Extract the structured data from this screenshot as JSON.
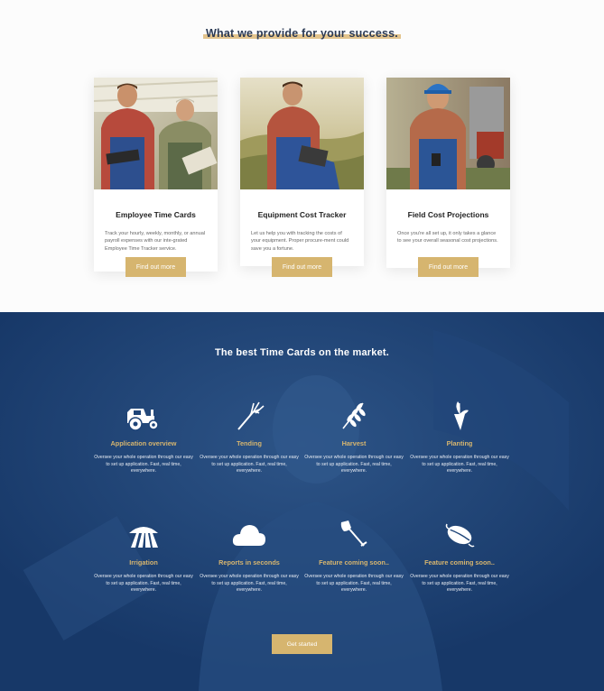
{
  "top_section": {
    "title": "What we provide for your success."
  },
  "cards": [
    {
      "title": "Employee Time Cards",
      "description": "Track your hourly, weekly, monthly, or annual payroll expenses with our inte-grated Employee Time Tracker service.",
      "button": "Find out more"
    },
    {
      "title": "Equipment Cost Tracker",
      "description": "Let us help you with tracking the costs of your equipment. Proper procure-ment could save you a fortune.",
      "button": "Find out more"
    },
    {
      "title": "Field Cost Projections",
      "description": "Once you're all set up, it only takes a glance to see your overall seasonal cost projections.",
      "button": "Find out more"
    }
  ],
  "features_section": {
    "title": "The best Time Cards on the market.",
    "button": "Get started"
  },
  "features": [
    {
      "icon": "tractor-icon",
      "title": "Application overview",
      "description": "Oversee your whole operation through our easy to set up application. Fast, real time, everywhere."
    },
    {
      "icon": "pitchfork-icon",
      "title": "Tending",
      "description": "Oversee your whole operation through our easy to set up application. Fast, real time, everywhere."
    },
    {
      "icon": "wheat-icon",
      "title": "Harvest",
      "description": "Oversee your whole operation through our easy to set up application. Fast, real time, everywhere."
    },
    {
      "icon": "plant-icon",
      "title": "Planting",
      "description": "Oversee your whole operation through our easy to set up application. Fast, real time, everywhere."
    },
    {
      "icon": "irrigation-icon",
      "title": "Irrigation",
      "description": "Oversee your whole operation through our easy to set up application. Fast, real time, everywhere."
    },
    {
      "icon": "cloud-icon",
      "title": "Reports in seconds",
      "description": "Oversee your whole operation through our easy to set up application. Fast, real time, everywhere."
    },
    {
      "icon": "shovel-icon",
      "title": "Feature coming soon..",
      "description": "Oversee your whole operation through our easy to set up application. Fast, real time, everywhere."
    },
    {
      "icon": "seed-icon",
      "title": "Feature coming soon..",
      "description": "Oversee your whole operation through our easy to set up application. Fast, real time, everywhere."
    }
  ],
  "colors": {
    "accent_gold": "#d6b56f",
    "navy": "#183a6a",
    "heading": "#2b3a55"
  }
}
